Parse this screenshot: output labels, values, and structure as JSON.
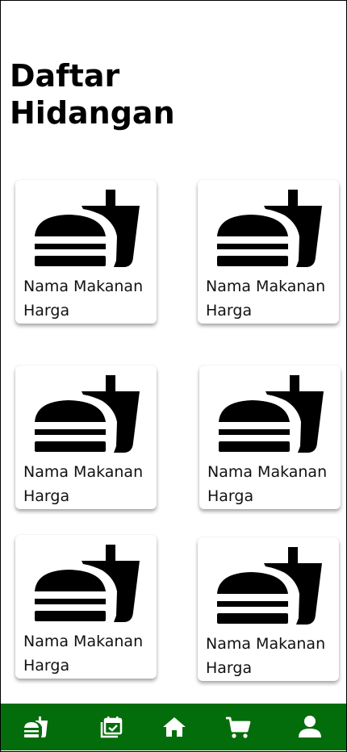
{
  "header": {
    "title": "Daftar\nHidangan"
  },
  "menu_items": [
    {
      "name": "Nama Makanan",
      "price": "Harga",
      "icon": "fastfood-icon"
    },
    {
      "name": "Nama Makanan",
      "price": "Harga",
      "icon": "fastfood-icon"
    },
    {
      "name": "Nama Makanan",
      "price": "Harga",
      "icon": "fastfood-icon"
    },
    {
      "name": "Nama Makanan",
      "price": "Harga",
      "icon": "fastfood-icon"
    },
    {
      "name": "Nama Makanan",
      "price": "Harga",
      "icon": "fastfood-icon"
    },
    {
      "name": "Nama Makanan",
      "price": "Harga",
      "icon": "fastfood-icon"
    }
  ],
  "bottom_nav": {
    "background_color": "#046d0b",
    "icon_color": "#ffffff",
    "items": [
      {
        "icon": "food-menu-icon"
      },
      {
        "icon": "calendar-check-icon"
      },
      {
        "icon": "home-icon"
      },
      {
        "icon": "cart-icon"
      },
      {
        "icon": "profile-icon"
      }
    ]
  }
}
